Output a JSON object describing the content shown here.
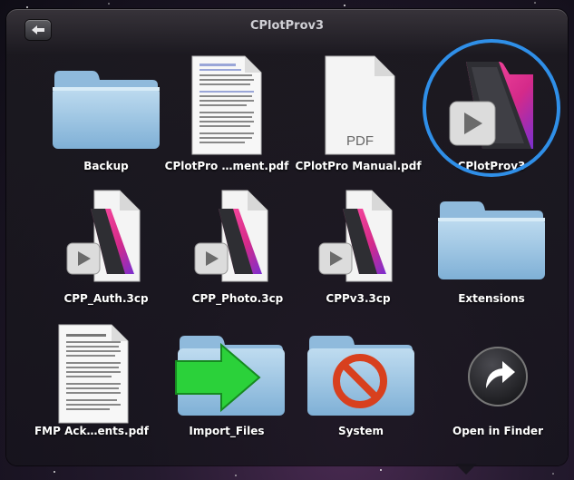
{
  "window": {
    "title": "CPlotProv3"
  },
  "back_button": {
    "icon": "back-arrow-icon"
  },
  "items": [
    {
      "label": "Backup",
      "kind": "folder",
      "icon": "folder-icon"
    },
    {
      "label": "CPlotPro …ment.pdf",
      "kind": "document",
      "icon": "document-icon"
    },
    {
      "label": "CPlotPro Manual.pdf",
      "kind": "pdf",
      "icon": "pdf-icon",
      "badge": "PDF"
    },
    {
      "label": "CPlotProv3",
      "kind": "filemaker-app",
      "icon": "filemaker-app-icon",
      "selected": true
    },
    {
      "label": "CPP_Auth.3cp",
      "kind": "filemaker-file",
      "icon": "filemaker-file-icon"
    },
    {
      "label": "CPP_Photo.3cp",
      "kind": "filemaker-file",
      "icon": "filemaker-file-icon"
    },
    {
      "label": "CPPv3.3cp",
      "kind": "filemaker-file",
      "icon": "filemaker-file-icon"
    },
    {
      "label": "Extensions",
      "kind": "folder",
      "icon": "folder-icon"
    },
    {
      "label": "FMP Ack…ents.pdf",
      "kind": "document",
      "icon": "document-icon"
    },
    {
      "label": "Import_Files",
      "kind": "folder-import",
      "icon": "import-folder-icon"
    },
    {
      "label": "System",
      "kind": "folder-restricted",
      "icon": "restricted-folder-icon"
    },
    {
      "label": "Open in Finder",
      "kind": "action",
      "icon": "open-in-finder-icon"
    }
  ],
  "colors": {
    "selection_ring": "#2f8fe8",
    "folder_blue": "#9cc6e4",
    "filemaker_pink": "#e8308a",
    "import_arrow": "#2bd13a",
    "restricted_red": "#d8401e"
  }
}
